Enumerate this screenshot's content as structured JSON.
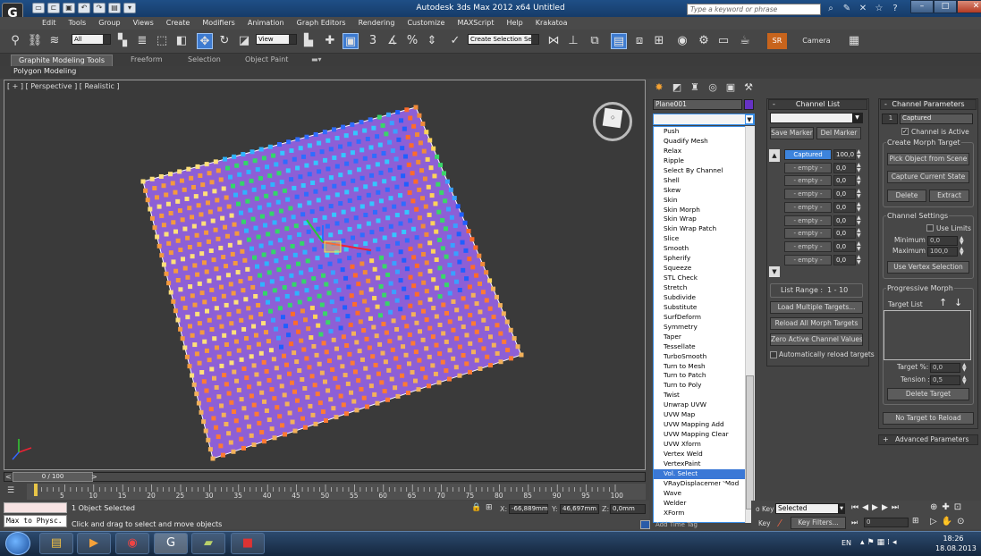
{
  "window": {
    "title": "Autodesk 3ds Max  2012 x64     Untitled",
    "search_placeholder": "Type a keyword or phrase",
    "logo_text": "G"
  },
  "menu": [
    "Edit",
    "Tools",
    "Group",
    "Views",
    "Create",
    "Modifiers",
    "Animation",
    "Graph Editors",
    "Rendering",
    "Customize",
    "MAXScript",
    "Help",
    "Krakatoa"
  ],
  "toolbar": {
    "filter_value": "All",
    "ref_coord_value": "View",
    "selection_set_value": "Create Selection Se",
    "sr_label": "SR",
    "camera_label": "Camera"
  },
  "ribbon": {
    "tabs": [
      "Graphite Modeling Tools",
      "Freeform",
      "Selection",
      "Object Paint"
    ],
    "sub_label": "Polygon Modeling"
  },
  "viewport": {
    "label": "[ + ] [ Perspective ] [ Realistic ]"
  },
  "timeline": {
    "frame_display": "0 / 100",
    "ticks": [
      "5",
      "10",
      "15",
      "20",
      "25",
      "30",
      "35",
      "40",
      "45",
      "50",
      "55",
      "60",
      "65",
      "70",
      "75",
      "80",
      "85",
      "90",
      "95",
      "100"
    ]
  },
  "status": {
    "maxscript_output": "Max to Physc.",
    "selected_text": "1 Object Selected",
    "prompt_text": "Click and drag to select and move objects",
    "x_value": "-66,889mm",
    "y_value": "46,697mm",
    "z_value": "0,0mm",
    "x_label": "X:",
    "y_label": "Y:",
    "z_label": "Z:"
  },
  "command_panel": {
    "object_name": "Plane001",
    "object_color": "#6632c4",
    "modifier_list": [
      "Push",
      "Quadify Mesh",
      "Relax",
      "Ripple",
      "Select By Channel",
      "Shell",
      "Skew",
      "Skin",
      "Skin Morph",
      "Skin Wrap",
      "Skin Wrap Patch",
      "Slice",
      "Smooth",
      "Spherify",
      "Squeeze",
      "STL Check",
      "Stretch",
      "Subdivide",
      "Substitute",
      "SurfDeform",
      "Symmetry",
      "Taper",
      "Tessellate",
      "TurboSmooth",
      "Turn to Mesh",
      "Turn to Patch",
      "Turn to Poly",
      "Twist",
      "Unwrap UVW",
      "UVW Map",
      "UVW Mapping Add",
      "UVW Mapping Clear",
      "UVW Xform",
      "Vertex Weld",
      "VertexPaint",
      "Vol. Select",
      "VRayDisplacementMod",
      "Wave",
      "Welder",
      "XForm"
    ],
    "selected_modifier": "Vol. Select"
  },
  "channel_list": {
    "header": "Channel List",
    "save_marker": "Save Marker",
    "del_marker": "Del Marker",
    "rows": [
      {
        "name": "Captured",
        "value": "100,0"
      },
      {
        "name": "- empty -",
        "value": "0,0"
      },
      {
        "name": "- empty -",
        "value": "0,0"
      },
      {
        "name": "- empty -",
        "value": "0,0"
      },
      {
        "name": "- empty -",
        "value": "0,0"
      },
      {
        "name": "- empty -",
        "value": "0,0"
      },
      {
        "name": "- empty -",
        "value": "0,0"
      },
      {
        "name": "- empty -",
        "value": "0,0"
      },
      {
        "name": "- empty -",
        "value": "0,0"
      },
      {
        "name": "- empty -",
        "value": "0,0"
      }
    ],
    "list_range_label": "List Range :",
    "list_range_value": "1 - 10",
    "load_multiple": "Load Multiple Targets...",
    "reload_all": "Reload All Morph Targets",
    "zero_active": "Zero Active Channel Values",
    "auto_reload": "Automatically reload targets"
  },
  "channel_params": {
    "header": "Channel Parameters",
    "channel_index": "1",
    "channel_name": "Captured",
    "channel_active": "Channel is Active",
    "create_morph_target": "Create Morph Target",
    "pick_object": "Pick Object from Scene",
    "capture_state": "Capture Current State",
    "delete": "Delete",
    "extract": "Extract",
    "channel_settings": "Channel Settings",
    "use_limits": "Use Limits",
    "minimum_label": "Minimum :",
    "minimum_value": "0,0",
    "maximum_label": "Maximum :",
    "maximum_value": "100,0",
    "use_vertex_selection": "Use Vertex Selection",
    "progressive_morph": "Progressive Morph",
    "target_list": "Target List",
    "target_pct_label": "Target %:",
    "target_pct_value": "0,0",
    "tension_label": "Tension :",
    "tension_value": "0,5",
    "delete_target": "Delete Target",
    "no_target_reload": "No Target to Reload",
    "advanced_params": "Advanced Parameters"
  },
  "anim_controls": {
    "set_key_label": "o Key",
    "selected_drop": "Selected",
    "key_label": "Key",
    "key_filters": "Key Filters...",
    "frame_value": "0",
    "add_time_tag": "Add Time Tag"
  },
  "taskbar": {
    "language": "EN",
    "time": "18:26",
    "date": "18.08.2013"
  }
}
